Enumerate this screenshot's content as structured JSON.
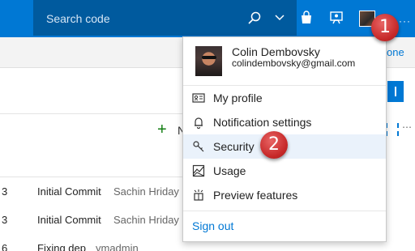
{
  "header": {
    "search_placeholder": "Search code",
    "more_label": "···"
  },
  "page": {
    "done_link": "one",
    "new_label": "N",
    "commits": [
      {
        "num": "3",
        "message": "Initial Commit",
        "author": "Sachin Hriday"
      },
      {
        "num": "3",
        "message": "Initial Commit",
        "author": "Sachin Hriday"
      },
      {
        "num": "6",
        "message": "Fixing dep",
        "author": "ymadmin"
      }
    ]
  },
  "menu": {
    "user_name": "Colin Dembovsky",
    "user_email": "colindembovsky@gmail.com",
    "items": [
      {
        "label": "My profile",
        "icon": "profile-card-icon"
      },
      {
        "label": "Notification settings",
        "icon": "bell-icon"
      },
      {
        "label": "Security",
        "icon": "key-icon"
      },
      {
        "label": "Usage",
        "icon": "usage-chart-icon"
      },
      {
        "label": "Preview features",
        "icon": "preview-features-icon"
      }
    ],
    "sign_out": "Sign out"
  },
  "callouts": {
    "one": "1",
    "two": "2"
  },
  "colors": {
    "accent": "#0078d4",
    "header_dark": "#005a9e",
    "badge": "#c62828",
    "hover": "#eaf2fb"
  }
}
